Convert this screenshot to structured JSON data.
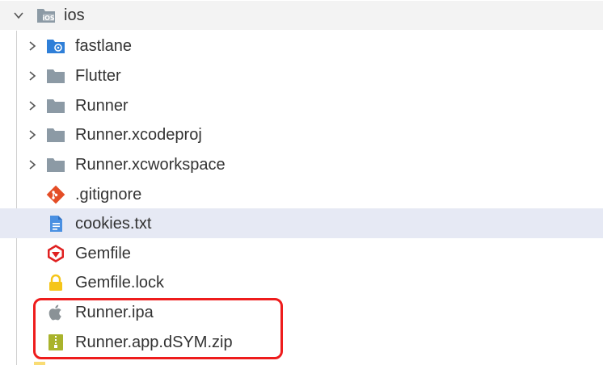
{
  "tree": {
    "root": {
      "label": "ios",
      "icon": "ios-folder-icon",
      "expanded": true
    },
    "items": [
      {
        "label": "fastlane",
        "icon": "fastlane-folder-icon",
        "kind": "folder"
      },
      {
        "label": "Flutter",
        "icon": "folder-icon",
        "kind": "folder"
      },
      {
        "label": "Runner",
        "icon": "folder-icon",
        "kind": "folder"
      },
      {
        "label": "Runner.xcodeproj",
        "icon": "folder-icon",
        "kind": "folder"
      },
      {
        "label": "Runner.xcworkspace",
        "icon": "folder-icon",
        "kind": "folder"
      },
      {
        "label": ".gitignore",
        "icon": "git-icon",
        "kind": "file"
      },
      {
        "label": "cookies.txt",
        "icon": "text-file-icon",
        "kind": "file",
        "selected": true
      },
      {
        "label": "Gemfile",
        "icon": "ruby-gem-icon",
        "kind": "file"
      },
      {
        "label": "Gemfile.lock",
        "icon": "lock-icon",
        "kind": "file"
      },
      {
        "label": "Runner.ipa",
        "icon": "apple-icon",
        "kind": "file"
      },
      {
        "label": "Runner.app.dSYM.zip",
        "icon": "zip-icon",
        "kind": "file"
      }
    ]
  },
  "colors": {
    "folder": "#8c9aa5",
    "selected_row": "#e6e9f4",
    "root_row": "#f3f3f3",
    "highlight": "#ee1c1c",
    "git": "#e44d26",
    "text_file": "#4a90e2",
    "gem": "#e02020",
    "lock": "#f5c518",
    "zip": "#a9b32c"
  }
}
